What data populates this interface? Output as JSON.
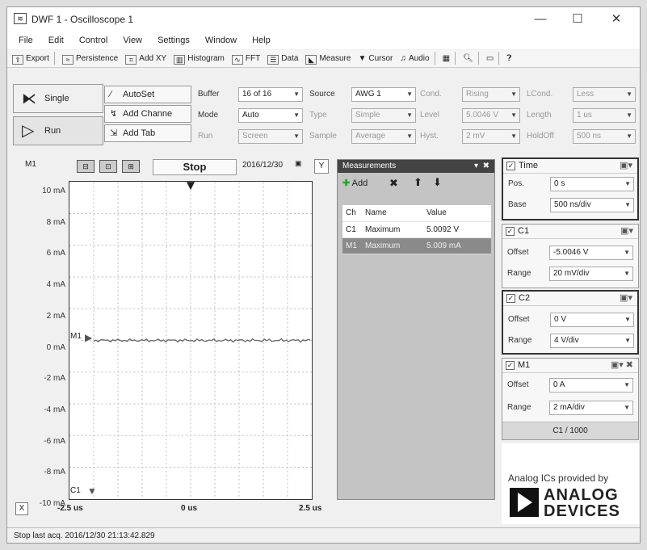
{
  "window": {
    "title": "DWF 1 - Oscilloscope 1",
    "minimize": "—",
    "maximize": "☐",
    "close": "✕"
  },
  "menu": [
    "File",
    "Edit",
    "Control",
    "View",
    "Settings",
    "Window",
    "Help"
  ],
  "toolbar": [
    {
      "label": "Export",
      "icon": "export-icon"
    },
    {
      "label": "Persistence",
      "icon": "persistence-icon"
    },
    {
      "label": "Add XY",
      "icon": "xy-icon"
    },
    {
      "label": "Histogram",
      "icon": "histogram-icon"
    },
    {
      "label": "FFT",
      "icon": "fft-icon"
    },
    {
      "label": "Data",
      "icon": "data-icon"
    },
    {
      "label": "Measure",
      "icon": "measure-icon"
    },
    {
      "label": "Cursor",
      "icon": "cursor-icon"
    },
    {
      "label": "Audio",
      "icon": "audio-icon"
    }
  ],
  "controls": {
    "single": "Single",
    "run": "Run",
    "autoset": "AutoSet",
    "add_channel": "Add Channe",
    "add_tab": "Add Tab",
    "buffer_label": "Buffer",
    "buffer_value": "16 of 16",
    "mode_label": "Mode",
    "mode_value": "Auto",
    "run_label": "Run",
    "run_value": "Screen",
    "source_label": "Source",
    "source_value": "AWG 1",
    "type_label": "Type",
    "type_value": "Simple",
    "sample_label": "Sample",
    "sample_value": "Average",
    "cond_label": "Cond.",
    "cond_value": "Rising",
    "level_label": "Level",
    "level_value": "5.0046 V",
    "hyst_label": "Hyst.",
    "hyst_value": "2 mV",
    "lcond_label": "LCond.",
    "lcond_value": "Less",
    "length_label": "Length",
    "length_value": "1 us",
    "holdoff_label": "HoldOff",
    "holdoff_value": "500 ns"
  },
  "scope": {
    "channel_label": "M1",
    "status": "Stop",
    "timestamp": "2016/12/30",
    "y_button": "Y",
    "y_ticks": [
      "10 mA",
      "8 mA",
      "6 mA",
      "4 mA",
      "2 mA",
      "0 mA",
      "-2 mA",
      "-4 mA",
      "-6 mA",
      "-8 mA",
      "-10 mA"
    ],
    "x_ticks": [
      "-2.5 us",
      "0 us",
      "2.5 us"
    ],
    "x_button": "X",
    "trace_marker": "M1",
    "c1_marker": "C1"
  },
  "measurements": {
    "title": "Measurements",
    "add": "Add",
    "columns": [
      "Ch",
      "Name",
      "Value"
    ],
    "rows": [
      [
        "C1",
        "Maximum",
        "5.0092 V"
      ],
      [
        "M1",
        "Maximum",
        "5.009 mA"
      ]
    ]
  },
  "time_panel": {
    "title": "Time",
    "pos_label": "Pos.",
    "pos_value": "0 s",
    "base_label": "Base",
    "base_value": "500 ns/div"
  },
  "c1_panel": {
    "title": "C1",
    "offset_label": "Offset",
    "offset_value": "-5.0046 V",
    "range_label": "Range",
    "range_value": "20 mV/div"
  },
  "c2_panel": {
    "title": "C2",
    "offset_label": "Offset",
    "offset_value": "0 V",
    "range_label": "Range",
    "range_value": "4 V/div"
  },
  "m1_panel": {
    "title": "M1",
    "offset_label": "Offset",
    "offset_value": "0 A",
    "range_label": "Range",
    "range_value": "2 mA/div",
    "formula": "C1 / 1000"
  },
  "logo": {
    "caption": "Analog ICs provided by",
    "line1": "ANALOG",
    "line2": "DEVICES"
  },
  "status_bar": "Stop last acq. 2016/12/30  21:13:42.829"
}
